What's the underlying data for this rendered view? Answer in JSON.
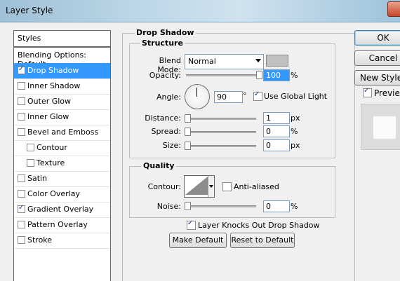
{
  "window": {
    "title": "Layer Style"
  },
  "styles_panel": {
    "header": "Styles",
    "items": [
      {
        "label": "Blending Options: Default",
        "checkbox": false,
        "checked": false,
        "selected": false,
        "indent": false
      },
      {
        "label": "Drop Shadow",
        "checkbox": true,
        "checked": true,
        "selected": true,
        "indent": false
      },
      {
        "label": "Inner Shadow",
        "checkbox": true,
        "checked": false,
        "selected": false,
        "indent": false
      },
      {
        "label": "Outer Glow",
        "checkbox": true,
        "checked": false,
        "selected": false,
        "indent": false
      },
      {
        "label": "Inner Glow",
        "checkbox": true,
        "checked": false,
        "selected": false,
        "indent": false
      },
      {
        "label": "Bevel and Emboss",
        "checkbox": true,
        "checked": false,
        "selected": false,
        "indent": false
      },
      {
        "label": "Contour",
        "checkbox": true,
        "checked": false,
        "selected": false,
        "indent": true
      },
      {
        "label": "Texture",
        "checkbox": true,
        "checked": false,
        "selected": false,
        "indent": true
      },
      {
        "label": "Satin",
        "checkbox": true,
        "checked": false,
        "selected": false,
        "indent": false
      },
      {
        "label": "Color Overlay",
        "checkbox": true,
        "checked": false,
        "selected": false,
        "indent": false
      },
      {
        "label": "Gradient Overlay",
        "checkbox": true,
        "checked": true,
        "selected": false,
        "indent": false
      },
      {
        "label": "Pattern Overlay",
        "checkbox": true,
        "checked": false,
        "selected": false,
        "indent": false
      },
      {
        "label": "Stroke",
        "checkbox": true,
        "checked": false,
        "selected": false,
        "indent": false
      }
    ]
  },
  "drop_shadow": {
    "title": "Drop Shadow",
    "structure": {
      "title": "Structure",
      "blend_mode_label": "Blend Mode:",
      "blend_mode_value": "Normal",
      "shadow_color": "#c0c0c0",
      "opacity_label": "Opacity:",
      "opacity_value": "100",
      "opacity_unit": "%",
      "opacity_fraction": 1.0,
      "angle_label": "Angle:",
      "angle_value": "90",
      "angle_unit": "°",
      "use_global_light_label": "Use Global Light",
      "use_global_light": true,
      "distance_label": "Distance:",
      "distance_value": "1",
      "distance_unit": "px",
      "spread_label": "Spread:",
      "spread_value": "0",
      "spread_unit": "%",
      "size_label": "Size:",
      "size_value": "0",
      "size_unit": "px"
    },
    "quality": {
      "title": "Quality",
      "contour_label": "Contour:",
      "anti_aliased_label": "Anti-aliased",
      "anti_aliased": false,
      "noise_label": "Noise:",
      "noise_value": "0",
      "noise_unit": "%"
    },
    "knockout_label": "Layer Knocks Out Drop Shadow",
    "knockout": true,
    "make_default_label": "Make Default",
    "reset_default_label": "Reset to Default"
  },
  "actions": {
    "ok_label": "OK",
    "cancel_label": "Cancel",
    "new_style_label": "New Style...",
    "preview_label": "Preview",
    "preview_checked": true
  }
}
